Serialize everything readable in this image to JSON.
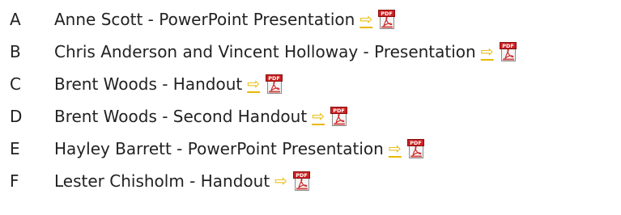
{
  "accent_color": "#e8b800",
  "pdf_icon_colors": {
    "badge": "#cc1f1f",
    "page": "#f4f4f4",
    "logo": "#cc1f1f"
  },
  "items": [
    {
      "letter": "A",
      "title": "Anne Scott - PowerPoint Presentation",
      "arrow": "⇨",
      "arrow_style": "link",
      "icon": "pdf-icon"
    },
    {
      "letter": "B",
      "title": "Chris Anderson and Vincent Holloway - Presentation",
      "arrow": "⇨",
      "arrow_style": "link",
      "icon": "pdf-icon"
    },
    {
      "letter": "C",
      "title": "Brent Woods - Handout",
      "arrow": "⇨",
      "arrow_style": "link",
      "icon": "pdf-icon"
    },
    {
      "letter": "D",
      "title": "Brent Woods - Second Handout",
      "arrow": "⇨",
      "arrow_style": "link",
      "icon": "pdf-icon"
    },
    {
      "letter": "E",
      "title": "Hayley Barrett - PowerPoint Presentation",
      "arrow": "⇨",
      "arrow_style": "link",
      "icon": "pdf-icon"
    },
    {
      "letter": "F",
      "title": "Lester Chisholm - Handout",
      "arrow": "⇨",
      "arrow_style": "plain",
      "icon": "pdf-icon"
    }
  ]
}
